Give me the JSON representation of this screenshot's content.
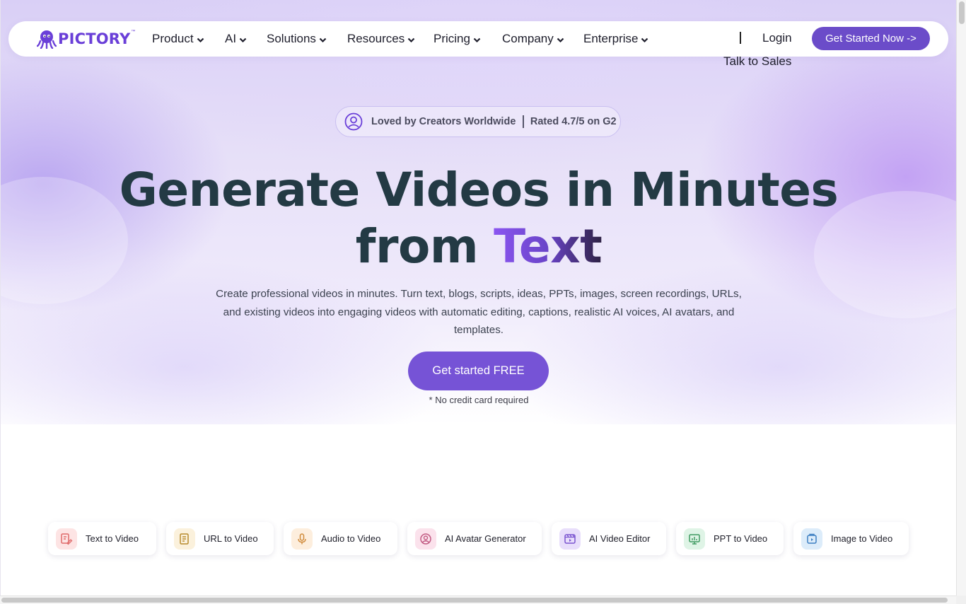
{
  "brand": {
    "name": "PICTORY",
    "tm": "™",
    "color": "#6a3fd8"
  },
  "nav": {
    "items": [
      {
        "label": "Product"
      },
      {
        "label": "AI"
      },
      {
        "label": "Solutions"
      },
      {
        "label": "Resources"
      },
      {
        "label": "Pricing"
      },
      {
        "label": "Company"
      },
      {
        "label": "Enterprise"
      }
    ],
    "login": "Login",
    "cta": "Get Started Now ->",
    "talk_to_sales": "Talk to Sales"
  },
  "badge": {
    "left": "Loved by Creators Worldwide",
    "right": "Rated 4.7/5 on G2",
    "icon": "user-circle-icon"
  },
  "hero": {
    "title_line1": "Generate Videos in Minutes",
    "title_line2_prefix": "from",
    "title_line2_highlight": "Text",
    "subtitle": "Create professional videos in minutes. Turn text, blogs, scripts, ideas, PPTs, images, screen recordings, URLs, and existing videos into engaging videos with automatic editing, captions, realistic AI voices, AI avatars, and templates.",
    "cta": "Get started FREE",
    "note": "* No credit card required",
    "accent": "#7653d6"
  },
  "features": [
    {
      "label": "Text to Video",
      "icon": "text-edit-icon",
      "bg": "#fde4e4",
      "fg": "#e06b6b"
    },
    {
      "label": "URL to Video",
      "icon": "document-icon",
      "bg": "#fbf1dc",
      "fg": "#b78a2c"
    },
    {
      "label": "Audio to Video",
      "icon": "microphone-icon",
      "bg": "#fdeedd",
      "fg": "#d08a3a"
    },
    {
      "label": "AI Avatar Generator",
      "icon": "avatar-icon",
      "bg": "#fbe2ec",
      "fg": "#c25b83"
    },
    {
      "label": "AI Video Editor",
      "icon": "video-editor-icon",
      "bg": "#e8defb",
      "fg": "#7a55d0"
    },
    {
      "label": "PPT to Video",
      "icon": "presentation-icon",
      "bg": "#dff4e6",
      "fg": "#3e9a60"
    },
    {
      "label": "Image to Video",
      "icon": "image-icon",
      "bg": "#dcecfa",
      "fg": "#3d7fc2"
    }
  ]
}
